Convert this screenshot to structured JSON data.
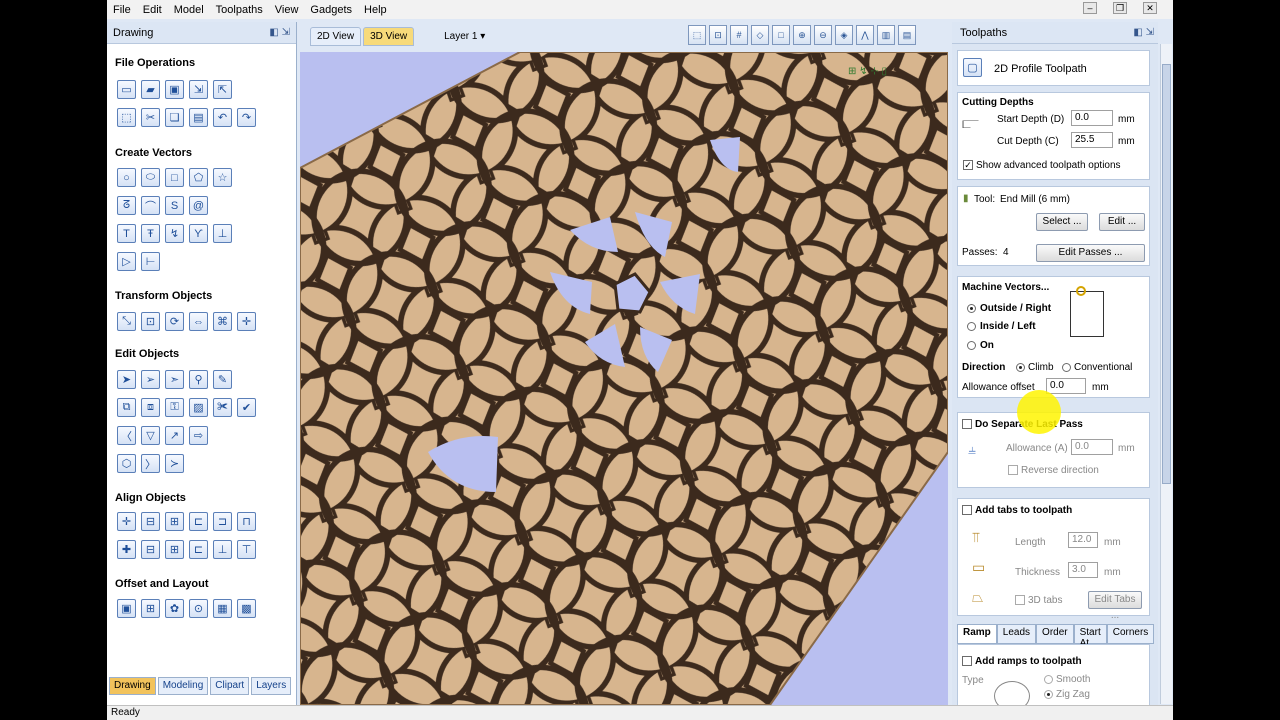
{
  "menu": [
    "File",
    "Edit",
    "Model",
    "Toolpaths",
    "View",
    "Gadgets",
    "Help"
  ],
  "left_panel": {
    "title": "Drawing",
    "sections": [
      "File Operations",
      "Create Vectors",
      "Transform Objects",
      "Edit Objects",
      "Align Objects",
      "Offset and Layout"
    ],
    "tabs": [
      "Drawing",
      "Modeling",
      "Clipart",
      "Layers"
    ]
  },
  "view": {
    "tab_2d": "2D View",
    "tab_3d": "3D View",
    "layer": "Layer 1 ▾"
  },
  "toolpaths": {
    "title": "Toolpaths",
    "name": "2D Profile Toolpath",
    "cutting_depths": "Cutting Depths",
    "start_depth_label": "Start Depth (D)",
    "start_depth": "0.0",
    "cut_depth_label": "Cut Depth (C)",
    "cut_depth": "25.5",
    "unit": "mm",
    "show_advanced": "Show advanced toolpath options",
    "tool_label": "Tool:",
    "tool_value": "End Mill (6 mm)",
    "select_btn": "Select ...",
    "edit_btn": "Edit ...",
    "passes_label": "Passes:",
    "passes_value": "4",
    "edit_passes_btn": "Edit Passes ...",
    "machine_vectors": "Machine Vectors...",
    "outside_right": "Outside / Right",
    "inside_left": "Inside / Left",
    "on": "On",
    "direction_label": "Direction",
    "climb": "Climb",
    "conventional": "Conventional",
    "allowance_label": "Allowance offset",
    "allowance_value": "0.0",
    "separate_last_pass": "Do Separate Last Pass",
    "allowance_a_label": "Allowance (A)",
    "allowance_a_value": "0.0",
    "reverse_direction": "Reverse direction",
    "add_tabs": "Add tabs to toolpath",
    "length_label": "Length",
    "length_value": "12.0",
    "thickness_label": "Thickness",
    "thickness_value": "3.0",
    "tabs_3d": "3D tabs",
    "edit_tabs_btn": "Edit Tabs ...",
    "bottom_tabs": [
      "Ramp",
      "Leads",
      "Order",
      "Start At",
      "Corners"
    ],
    "add_ramps": "Add ramps to toolpath",
    "type_label": "Type",
    "smooth": "Smooth",
    "zigzag": "Zig Zag"
  },
  "status": "Ready",
  "colors": {
    "wood": "#d7b58e",
    "cut": "#3c2a1d",
    "background": "#b9bff0"
  }
}
